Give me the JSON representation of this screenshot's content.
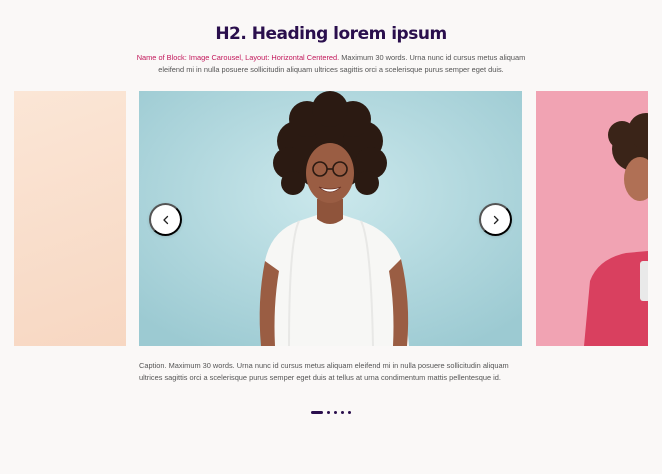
{
  "heading": "H2. Heading lorem ipsum",
  "intro": {
    "highlight": "Name of Block: Image Carousel, Layout: Horizontal Centered.",
    "body": " Maximum 30 words. Urna nunc id cursus metus aliquam eleifend mi in nulla posuere sollicitudin aliquam ultrices sagittis orci a scelerisque purus semper eget duis."
  },
  "caption": "Caption. Maximum 30 words. Urna nunc id cursus metus aliquam eleifend mi in nulla posuere sollicitudin aliquam ultrices sagittis orci a scelerisque purus semper eget duis at tellus at urna condimentum mattis pellentesque id.",
  "carousel": {
    "slide_count": 5,
    "active_slide": 1,
    "prev_icon": "chevron-left-icon",
    "next_icon": "chevron-right-icon"
  },
  "colors": {
    "heading": "#2a0f4d",
    "highlight": "#c2185b",
    "background": "#faf8f7"
  }
}
